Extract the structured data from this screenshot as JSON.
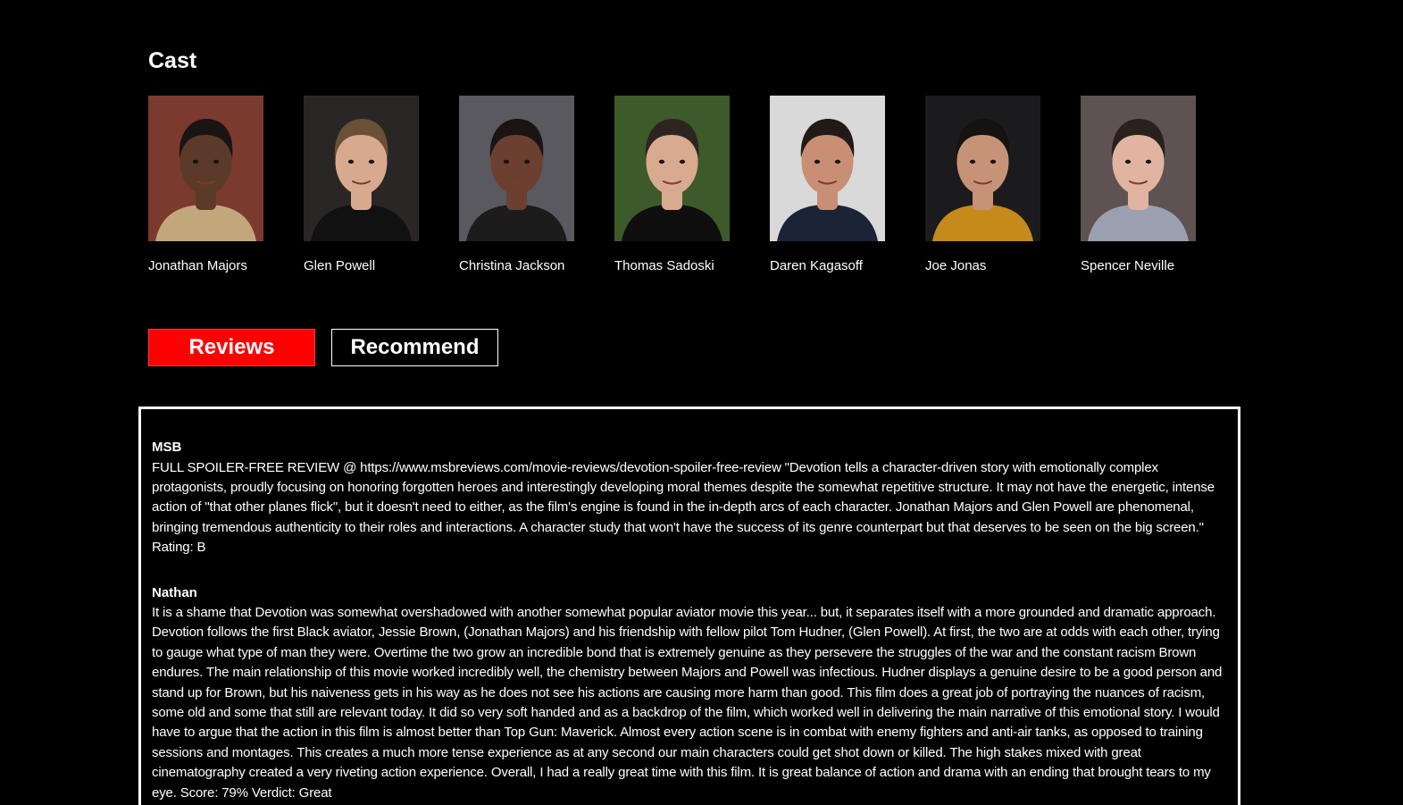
{
  "cast": {
    "title": "Cast",
    "members": [
      {
        "name": "Jonathan Majors",
        "icon": "headshot-photo",
        "bg": "#7a3a2e",
        "skin": "#5b3a2a",
        "hair": "#1a1412",
        "shirt": "#c2a77a"
      },
      {
        "name": "Glen Powell",
        "icon": "headshot-photo",
        "bg": "#2a2626",
        "skin": "#d7a98e",
        "hair": "#6b5038",
        "shirt": "#111111"
      },
      {
        "name": "Christina Jackson",
        "icon": "headshot-photo",
        "bg": "#5a5960",
        "skin": "#6b4030",
        "hair": "#1b1413",
        "shirt": "#1c1c1c"
      },
      {
        "name": "Thomas Sadoski",
        "icon": "headshot-photo",
        "bg": "#3d5a2a",
        "skin": "#d8aa90",
        "hair": "#2d241f",
        "shirt": "#0f0f0f"
      },
      {
        "name": "Daren Kagasoff",
        "icon": "headshot-photo",
        "bg": "#d9d9d9",
        "skin": "#c98f74",
        "hair": "#221a16",
        "shirt": "#1b2436"
      },
      {
        "name": "Joe Jonas",
        "icon": "headshot-photo",
        "bg": "#1b1b1d",
        "skin": "#c79376",
        "hair": "#151212",
        "shirt": "#c48a1a"
      },
      {
        "name": "Spencer Neville",
        "icon": "headshot-photo",
        "bg": "#5e5252",
        "skin": "#e0b4a0",
        "hair": "#2a201c",
        "shirt": "#9aa0b0"
      }
    ]
  },
  "tabs": [
    {
      "label": "Reviews",
      "active": true
    },
    {
      "label": "Recommend",
      "active": false
    }
  ],
  "reviews": [
    {
      "author": "MSB",
      "text": "FULL SPOILER-FREE REVIEW @ https://www.msbreviews.com/movie-reviews/devotion-spoiler-free-review \"Devotion tells a character-driven story with emotionally complex protagonists, proudly focusing on honoring forgotten heroes and interestingly developing moral themes despite the somewhat repetitive structure. It may not have the energetic, intense action of \"that other planes flick\", but it doesn't need to either, as the film's engine is found in the in-depth arcs of each character. Jonathan Majors and Glen Powell are phenomenal, bringing tremendous authenticity to their roles and interactions. A character study that won't have the success of its genre counterpart but that deserves to be seen on the big screen.\" Rating: B"
    },
    {
      "author": "Nathan",
      "text": "It is a shame that Devotion was somewhat overshadowed with another somewhat popular aviator movie this year... but, it separates itself with a more grounded and dramatic approach. Devotion follows the first Black aviator, Jessie Brown, (Jonathan Majors) and his friendship with fellow pilot Tom Hudner, (Glen Powell). At first, the two are at odds with each other, trying to gauge what type of man they were. Overtime the two grow an incredible bond that is extremely genuine as they persevere the struggles of the war and the constant racism Brown endures. The main relationship of this movie worked incredibly well, the chemistry between Majors and Powell was infectious. Hudner displays a genuine desire to be a good person and stand up for Brown, but his naiveness gets in his way as he does not see his actions are causing more harm than good. This film does a great job of portraying the nuances of racism, some old and some that still are relevant today. It did so very soft handed and as a backdrop of the film, which worked well in delivering the main narrative of this emotional story. I would have to argue that the action in this film is almost better than Top Gun: Maverick. Almost every action scene is in combat with enemy fighters and anti-air tanks, as opposed to training sessions and montages. This creates a much more tense experience as at any second our main characters could get shot down or killed. The high stakes mixed with great cinematography created a very riveting action experience. Overall, I had a really great time with this film. It is great balance of action and drama with an ending that brought tears to my eye. Score: 79% Verdict: Great"
    }
  ]
}
